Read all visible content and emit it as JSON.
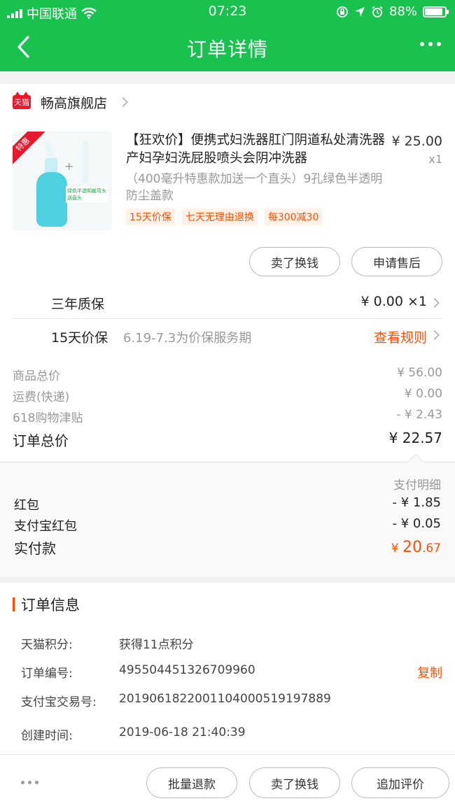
{
  "status": {
    "carrier": "中国联通",
    "time": "07:23",
    "battery": "88%",
    "battery_level": 0.88
  },
  "nav": {
    "title": "订单详情"
  },
  "store": {
    "badge": "天猫",
    "name": "畅高旗舰店"
  },
  "product": {
    "badge": "特惠",
    "image_label": "绿色半透明扁弯头送直头",
    "title": "【狂欢价】便携式妇洗器肛门阴道私处清洗器 产妇孕妇洗屁股喷头会阴冲洗器",
    "sku": "（400毫升特惠款加送一个直头）9孔绿色半透明防尘盖款",
    "price": "¥ 25.00",
    "qty": "x1",
    "tags": [
      "15天价保",
      "七天无理由退换",
      "每300减30"
    ],
    "btn_sell": "卖了换钱",
    "btn_after_sale": "申请售后"
  },
  "services": {
    "warranty_name": "三年质保",
    "warranty_value": "¥ 0.00 ×1",
    "price_protect_name": "15天价保",
    "price_protect_desc": "6.19-7.3为价保服务期",
    "price_protect_link": "查看规则"
  },
  "summary": {
    "goods_label": "商品总价",
    "goods_value": "¥ 56.00",
    "shipping_label": "运费(快递)",
    "shipping_value": "¥ 0.00",
    "subsidy_label": "618购物津贴",
    "subsidy_value": "- ¥ 2.43",
    "total_label": "订单总价",
    "total_value": "¥ 22.57"
  },
  "payment": {
    "detail_label": "支付明细",
    "redpacket_label": "红包",
    "redpacket_value": "- ¥ 1.85",
    "alipay_redpacket_label": "支付宝红包",
    "alipay_redpacket_value": "- ¥ 0.05",
    "paid_label": "实付款",
    "paid_currency": "¥ ",
    "paid_int": "20",
    "paid_dec": ".67"
  },
  "order_info": {
    "heading": "订单信息",
    "points_label": "天猫积分:",
    "points_value": "获得11点积分",
    "order_no_label": "订单编号:",
    "order_no_value": "495504451326709960",
    "copy_label": "复制",
    "alipay_no_label": "支付宝交易号:",
    "alipay_no_value": "2019061822001104000519197889",
    "created_label": "创建时间:",
    "created_value": "2019-06-18 21:40:39"
  },
  "bottom": {
    "btn_batch_refund": "批量退款",
    "btn_sell": "卖了换钱",
    "btn_review": "追加评价"
  },
  "colors": {
    "brand_green": "#19c24e",
    "accent_orange": "#ff5000",
    "tmall_red": "#e6192d"
  }
}
